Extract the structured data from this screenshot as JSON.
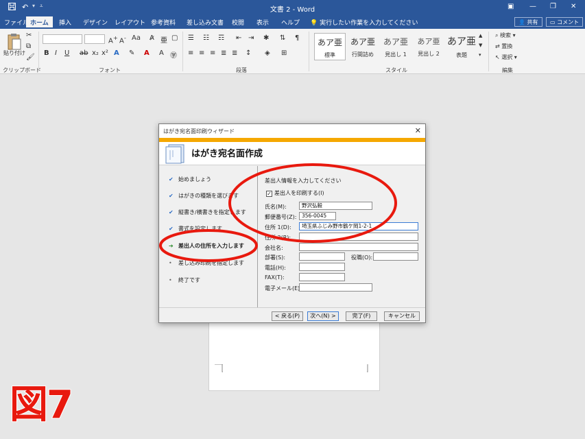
{
  "window": {
    "title": "文書 2  -  Word",
    "quick_access": [
      "save-icon",
      "undo-icon",
      "customize-icon"
    ]
  },
  "ribbon_tabs": {
    "items": [
      "ファイル",
      "ホーム",
      "挿入",
      "デザイン",
      "レイアウト",
      "参考資料",
      "差し込み文書",
      "校閲",
      "表示",
      "ヘルプ"
    ],
    "active": "ホーム",
    "tell_me": "実行したい作業を入力してください",
    "share": "共有",
    "comment": "コメント"
  },
  "ribbon": {
    "clipboard": {
      "paste_label": "貼り付け",
      "group": "クリップボード"
    },
    "font": {
      "group": "フォント"
    },
    "paragraph": {
      "group": "段落"
    },
    "styles": {
      "group": "スタイル",
      "items": [
        {
          "preview": "あア亜",
          "name": "標準"
        },
        {
          "preview": "あア亜",
          "name": "行間詰め"
        },
        {
          "preview": "あア亜",
          "name": "見出し 1"
        },
        {
          "preview": "あア亜",
          "name": "見出し 2"
        },
        {
          "preview": "あア亜",
          "name": "表題"
        }
      ]
    },
    "editing": {
      "group": "編集",
      "find": "検索",
      "replace": "置換",
      "select": "選択"
    }
  },
  "dialog": {
    "title": "はがき宛名面印刷ウィザード",
    "heading": "はがき宛名面作成",
    "steps": [
      {
        "label": "始めましょう",
        "state": "done"
      },
      {
        "label": "はがきの種類を選びます",
        "state": "done"
      },
      {
        "label": "縦書き/横書きを指定します",
        "state": "done"
      },
      {
        "label": "書式を設定します",
        "state": "done"
      },
      {
        "label": "差出人の住所を入力します",
        "state": "current"
      },
      {
        "label": "差し込み印刷を指定します",
        "state": "todo"
      },
      {
        "label": "終了です",
        "state": "todo"
      }
    ],
    "instruction": "差出人情報を入力してください",
    "print_sender_label": "差出人を印刷する(I)",
    "print_sender_checked": true,
    "fields": {
      "name": {
        "label": "氏名(M):",
        "value": "野沢弘毅"
      },
      "postal": {
        "label": "郵便番号(Z):",
        "value": "356-0045"
      },
      "address1": {
        "label": "住所 1(D):",
        "value": "埼玉県ふじみ野市鶴ケ岡1-2-1"
      },
      "address2": {
        "label": "住所 2(R):",
        "value": ""
      },
      "company": {
        "label": "会社名:",
        "value": ""
      },
      "department": {
        "label": "部署(S):",
        "value": ""
      },
      "position": {
        "label": "役職(O):",
        "value": ""
      },
      "phone": {
        "label": "電話(H):",
        "value": ""
      },
      "fax": {
        "label": "FAX(T):",
        "value": ""
      },
      "email": {
        "label": "電子メール(E):",
        "value": ""
      }
    },
    "buttons": {
      "back": "< 戻る(P)",
      "next": "次へ(N) >",
      "finish": "完了(F)",
      "cancel": "キャンセル"
    }
  },
  "figure_label": "図7",
  "colors": {
    "word_blue": "#2b579a",
    "wizard_band": "#f5a800",
    "annotation_red": "#e8190e"
  }
}
